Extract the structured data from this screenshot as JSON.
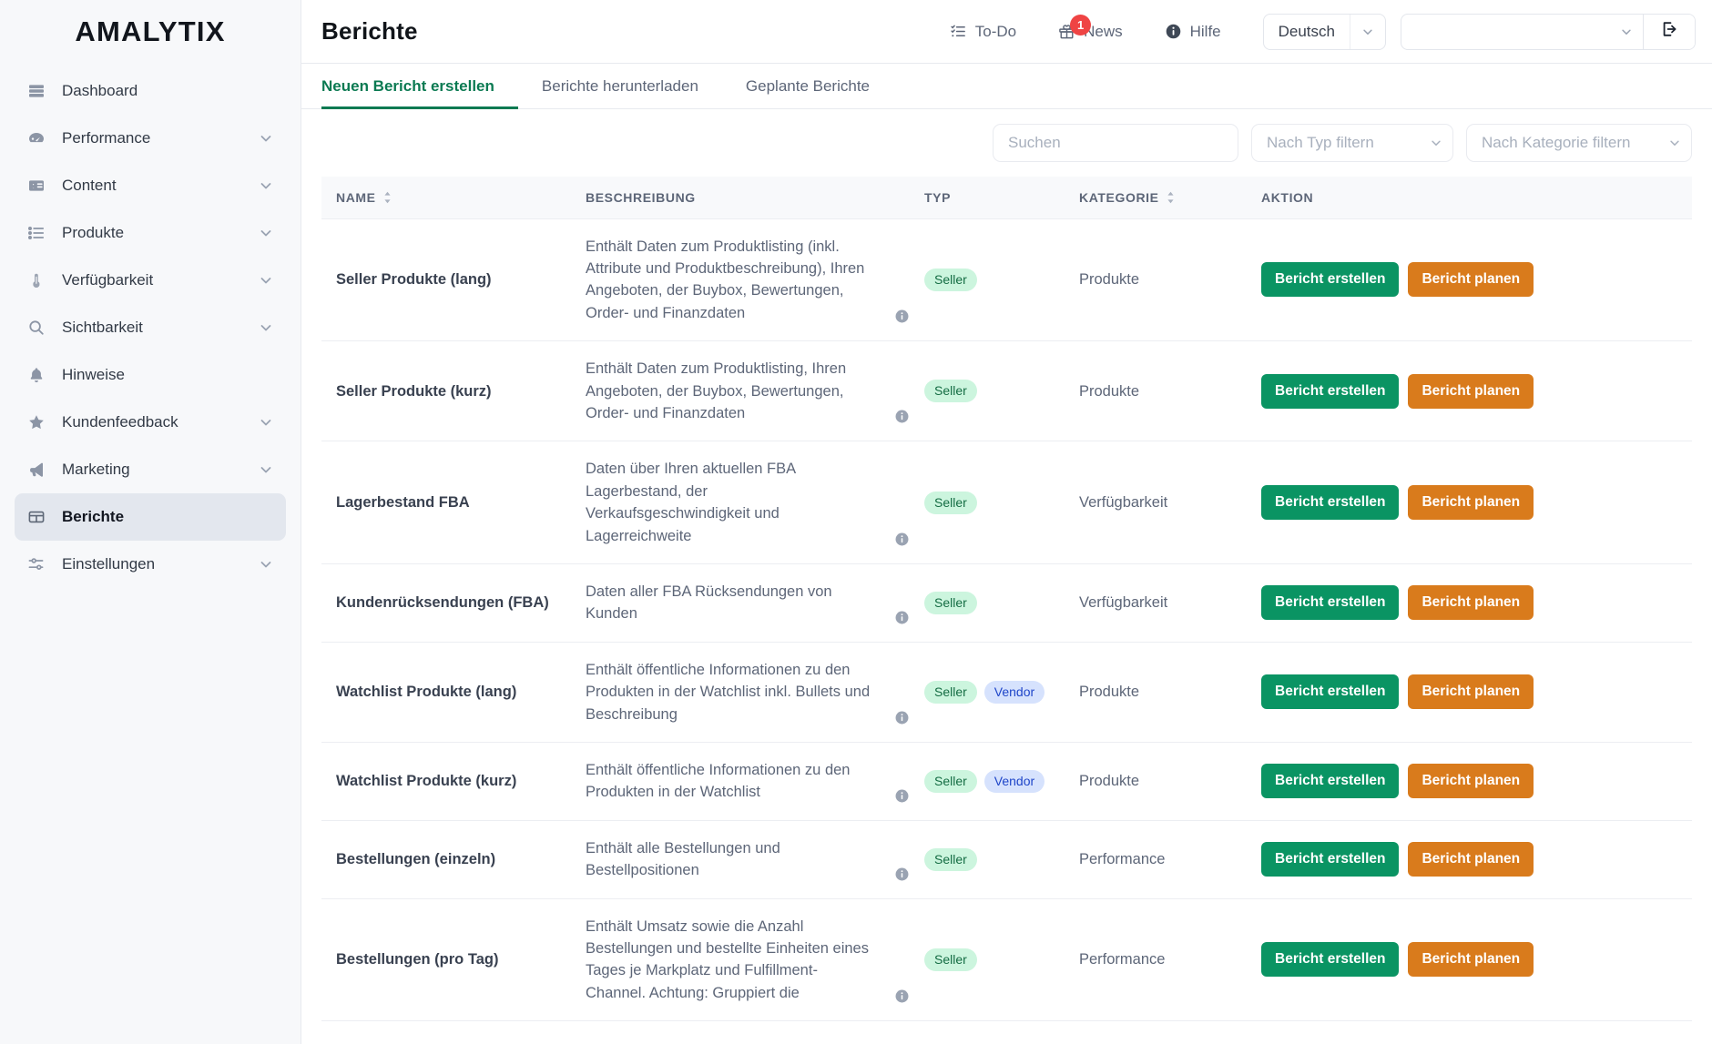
{
  "brand": {
    "name": "AMALYTIX"
  },
  "sidebar": {
    "items": [
      {
        "label": "Dashboard",
        "icon": "dashboard-icon",
        "expandable": false,
        "active": false
      },
      {
        "label": "Performance",
        "icon": "gauge-icon",
        "expandable": true,
        "active": false
      },
      {
        "label": "Content",
        "icon": "id-card-icon",
        "expandable": true,
        "active": false
      },
      {
        "label": "Produkte",
        "icon": "list-icon",
        "expandable": true,
        "active": false
      },
      {
        "label": "Verfügbarkeit",
        "icon": "thermometer-icon",
        "expandable": true,
        "active": false
      },
      {
        "label": "Sichtbarkeit",
        "icon": "magnifier-icon",
        "expandable": true,
        "active": false
      },
      {
        "label": "Hinweise",
        "icon": "bell-icon",
        "expandable": false,
        "active": false
      },
      {
        "label": "Kundenfeedback",
        "icon": "star-icon",
        "expandable": true,
        "active": false
      },
      {
        "label": "Marketing",
        "icon": "megaphone-icon",
        "expandable": true,
        "active": false
      },
      {
        "label": "Berichte",
        "icon": "table-icon",
        "expandable": false,
        "active": true
      },
      {
        "label": "Einstellungen",
        "icon": "sliders-icon",
        "expandable": true,
        "active": false
      }
    ]
  },
  "topbar": {
    "title": "Berichte",
    "todo_label": "To-Do",
    "news_label": "News",
    "news_badge_count": "1",
    "help_label": "Hilfe",
    "language_value": "Deutsch",
    "account_value": ""
  },
  "tabs": [
    {
      "label": "Neuen Bericht erstellen",
      "active": true
    },
    {
      "label": "Berichte herunterladen",
      "active": false
    },
    {
      "label": "Geplante Berichte",
      "active": false
    }
  ],
  "filters": {
    "search_value": "",
    "search_placeholder": "Suchen",
    "type_filter_label": "Nach Typ filtern",
    "category_filter_label": "Nach Kategorie filtern"
  },
  "table": {
    "columns": [
      {
        "label": "NAME",
        "sortable": true
      },
      {
        "label": "BESCHREIBUNG",
        "sortable": false
      },
      {
        "label": "TYP",
        "sortable": false
      },
      {
        "label": "KATEGORIE",
        "sortable": true
      },
      {
        "label": "AKTION",
        "sortable": false
      }
    ],
    "create_button_label": "Bericht erstellen",
    "plan_button_label": "Bericht planen",
    "rows": [
      {
        "name": "Seller Produkte (lang)",
        "description": "Enthält Daten zum Produktlisting (inkl. Attribute und Produktbeschreibung), Ihren Angeboten, der Buybox, Bewertungen, Order- und Finanzdaten",
        "types": [
          "Seller"
        ],
        "category": "Produkte"
      },
      {
        "name": "Seller Produkte (kurz)",
        "description": "Enthält Daten zum Produktlisting, Ihren Angeboten, der Buybox, Bewertungen, Order- und Finanzdaten",
        "types": [
          "Seller"
        ],
        "category": "Produkte"
      },
      {
        "name": "Lagerbestand FBA",
        "description": "Daten über Ihren aktuellen FBA Lagerbestand, der Verkaufsgeschwindigkeit und Lagerreichweite",
        "types": [
          "Seller"
        ],
        "category": "Verfügbarkeit"
      },
      {
        "name": "Kundenrücksendungen (FBA)",
        "description": "Daten aller FBA Rücksendungen von Kunden",
        "types": [
          "Seller"
        ],
        "category": "Verfügbarkeit"
      },
      {
        "name": "Watchlist Produkte (lang)",
        "description": "Enthält öffentliche Informationen zu den Produkten in der Watchlist inkl. Bullets und Beschreibung",
        "types": [
          "Seller",
          "Vendor"
        ],
        "category": "Produkte"
      },
      {
        "name": "Watchlist Produkte (kurz)",
        "description": "Enthält öffentliche Informationen zu den Produkten in der Watchlist",
        "types": [
          "Seller",
          "Vendor"
        ],
        "category": "Produkte"
      },
      {
        "name": "Bestellungen (einzeln)",
        "description": "Enthält alle Bestellungen und Bestellpositionen",
        "types": [
          "Seller"
        ],
        "category": "Performance"
      },
      {
        "name": "Bestellungen (pro Tag)",
        "description": "Enthält Umsatz sowie die Anzahl Bestellungen und bestellte Einheiten eines Tages je Markplatz und Fulfillment-Channel. Achtung: Gruppiert die",
        "types": [
          "Seller"
        ],
        "category": "Performance"
      }
    ]
  },
  "colors": {
    "accent_green": "#0a9463",
    "accent_orange": "#d97b1c",
    "tab_active": "#0b7a52",
    "badge_seller_bg": "#ccf5de",
    "badge_seller_text": "#146c43",
    "badge_vendor_bg": "#d6e2fd",
    "badge_vendor_text": "#1f46c9",
    "news_badge": "#ef4444",
    "sidebar_bg": "#f7f8fa",
    "sidebar_active_bg": "#e3e7ee"
  }
}
